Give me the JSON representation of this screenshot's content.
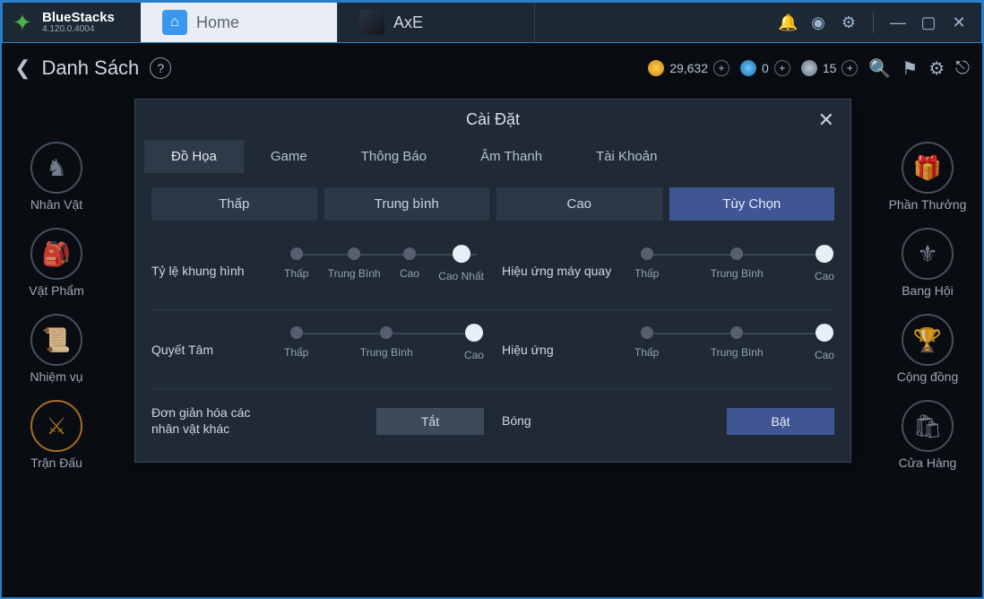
{
  "bluestacks": {
    "name": "BlueStacks",
    "version": "4.120.0.4004"
  },
  "tabs": {
    "home": "Home",
    "game": "AxE"
  },
  "game_top": {
    "back_label": "Danh Sách",
    "currency": {
      "gold": "29,632",
      "gem": "0",
      "diamond": "15"
    }
  },
  "side_left": {
    "item0": "Nhân Vật",
    "item1": "Vật Phẩm",
    "item2": "Nhiệm vụ",
    "item3": "Trận Đấu"
  },
  "side_right": {
    "item0": "Phần Thưởng",
    "item1": "Bang Hội",
    "item2": "Cộng đồng",
    "item3": "Cửa Hàng"
  },
  "modal": {
    "title": "Cài Đặt",
    "tabs": {
      "t0": "Đồ Họa",
      "t1": "Game",
      "t2": "Thông Báo",
      "t3": "Âm Thanh",
      "t4": "Tài Khoản"
    },
    "presets": {
      "p0": "Thấp",
      "p1": "Trung bình",
      "p2": "Cao",
      "p3": "Tùy Chọn"
    },
    "opts": {
      "frame_rate": "Tỷ lệ khung hình",
      "camera_fx": "Hiệu ứng máy quay",
      "determination": "Quyết Tâm",
      "effects": "Hiệu ứng",
      "simplify": "Đơn giản hóa các nhân vật khác",
      "shadow": "Bóng"
    },
    "slider4": {
      "s0": "Thấp",
      "s1": "Trung Bình",
      "s2": "Cao",
      "s3": "Cao Nhất"
    },
    "slider3": {
      "s0": "Thấp",
      "s1": "Trung Bình",
      "s2": "Cao"
    },
    "toggle": {
      "off": "Tắt",
      "on": "Bật"
    }
  }
}
